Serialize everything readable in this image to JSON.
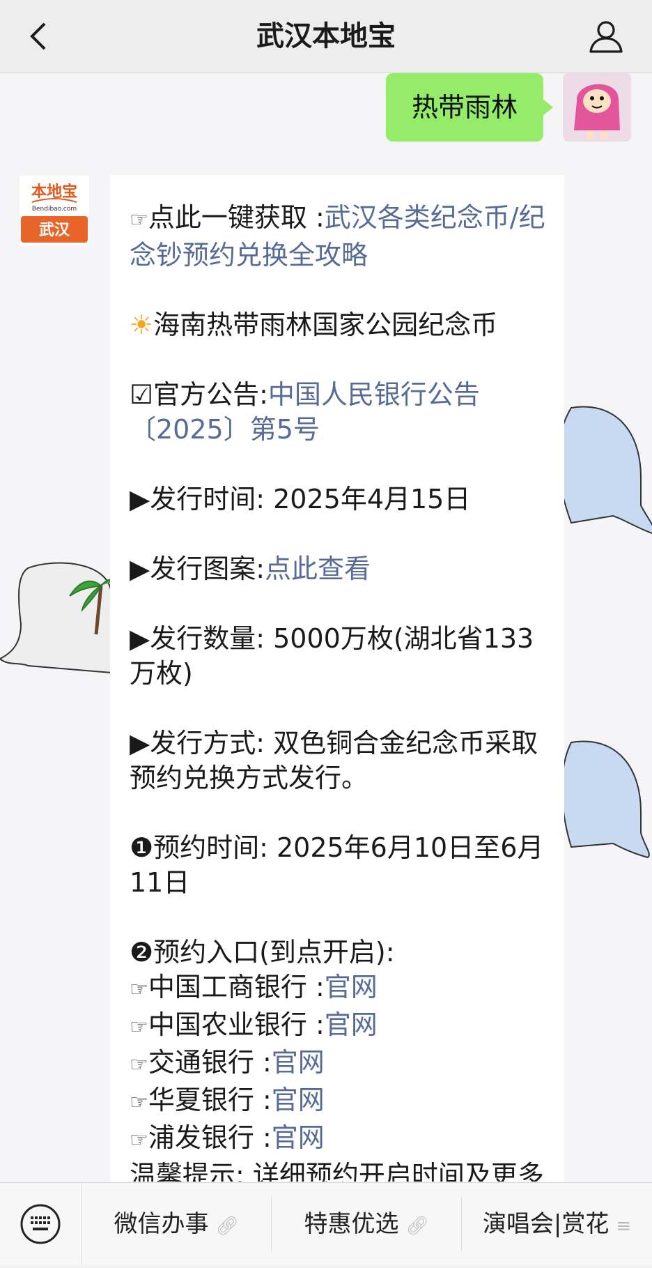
{
  "header": {
    "title": "武汉本地宝"
  },
  "chat": {
    "user_message": "热带雨林",
    "bot_logo": {
      "top": "本地宝",
      "mid": "Bendibao.com",
      "bottom": "武汉"
    },
    "lines": {
      "l1_prefix": "点此一键获取 :",
      "l1_link": "武汉各类纪念币/纪念钞预约兑换全攻略",
      "l2": "海南热带雨林国家公园纪念币",
      "l3_prefix": "官方公告:",
      "l3_link": "中国人民银行公告〔2025〕第5号",
      "l4": "发行时间: 2025年4月15日",
      "l5_prefix": "发行图案:",
      "l5_link": "点此查看",
      "l6": "发行数量: 5000万枚(湖北省133万枚)",
      "l7": "发行方式: 双色铜合金纪念币采取预约兑换方式发行。",
      "l8": "预约时间: 2025年6月10日至6月11日",
      "l9": "预约入口(到点开启):",
      "banks": [
        {
          "name": "中国工商银行 :",
          "link": "官网"
        },
        {
          "name": "中国农业银行 :",
          "link": "官网"
        },
        {
          "name": "交通银行 :",
          "link": "官网"
        },
        {
          "name": "华夏银行 :",
          "link": "官网"
        },
        {
          "name": "浦发银行 :",
          "link": "官网"
        }
      ],
      "tip": "温馨提示: 详细预约开启时间及更多预约入口持续关注更新中"
    }
  },
  "bottom_menu": [
    {
      "label": "微信办事",
      "icon": "link-icon"
    },
    {
      "label": "特惠优选",
      "icon": "link-icon"
    },
    {
      "label": "演唱会|赏花",
      "icon": "menu-icon"
    }
  ]
}
